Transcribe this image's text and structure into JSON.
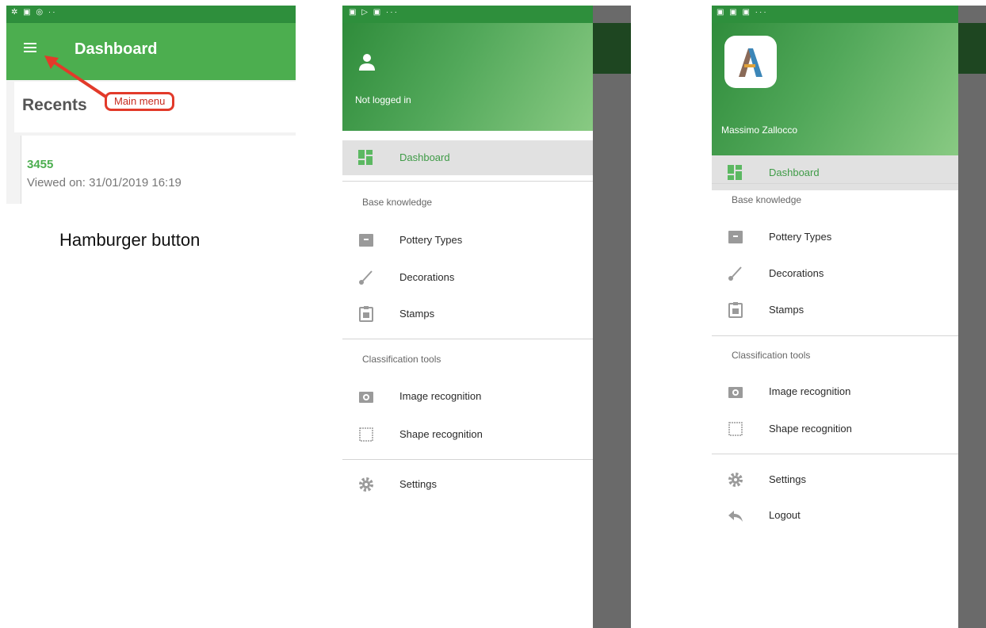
{
  "panel1": {
    "app_title": "Dashboard",
    "recents_heading": "Recents",
    "recent_item": {
      "number": "3455",
      "viewed": "Viewed on: 31/01/2019 16:19"
    },
    "annotation_label": "Main menu",
    "caption": "Hamburger button"
  },
  "drawer_logged_out": {
    "user": "Not logged in",
    "dashboard": "Dashboard",
    "section_base": "Base knowledge",
    "pottery_types": "Pottery Types",
    "decorations": "Decorations",
    "stamps": "Stamps",
    "section_tools": "Classification tools",
    "image_recognition": "Image recognition",
    "shape_recognition": "Shape recognition",
    "settings": "Settings"
  },
  "drawer_logged_in": {
    "user": "Massimo Zallocco",
    "dashboard": "Dashboard",
    "section_base": "Base knowledge",
    "pottery_types": "Pottery Types",
    "decorations": "Decorations",
    "stamps": "Stamps",
    "section_tools": "Classification tools",
    "image_recognition": "Image recognition",
    "shape_recognition": "Shape recognition",
    "settings": "Settings",
    "logout": "Logout"
  },
  "colors": {
    "primary": "#4cae4f",
    "status_bar": "#2e8f3c",
    "annotation": "#e23a2a"
  }
}
